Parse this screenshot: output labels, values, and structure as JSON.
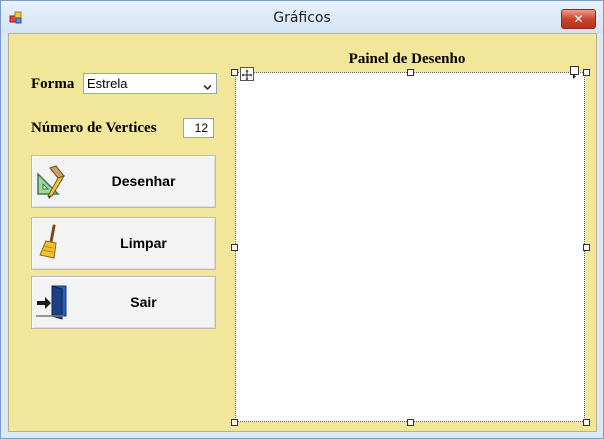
{
  "window": {
    "title": "Gráficos",
    "close_label": "✕"
  },
  "form": {
    "forma_label": "Forma",
    "forma_value": "Estrela",
    "vertices_label": "Número de Vertices",
    "vertices_value": "12"
  },
  "buttons": {
    "desenhar": "Desenhar",
    "limpar": "Limpar",
    "sair": "Sair"
  },
  "panel": {
    "title": "Painel de Desenho"
  },
  "colors": {
    "background": "#f1e69a",
    "panel": "#ffffff"
  }
}
